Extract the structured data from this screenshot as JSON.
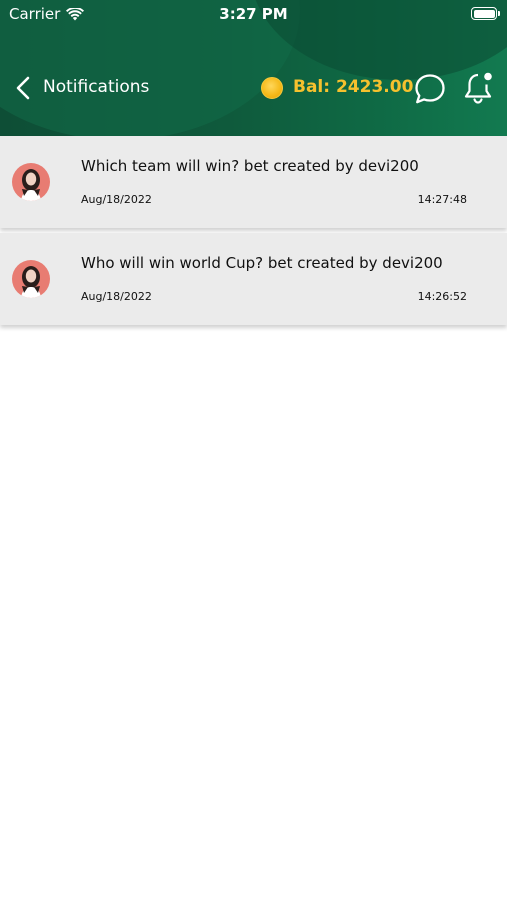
{
  "status_bar": {
    "carrier": "Carrier",
    "time": "3:27 PM"
  },
  "header": {
    "title": "Notifications",
    "balance": "Bal: 2423.00",
    "colors": {
      "background": "#0f5a3c",
      "balance": "#f6c12e"
    }
  },
  "notifications": [
    {
      "message": "Which team will win? bet created by devi200",
      "date": "Aug/18/2022",
      "time": "14:27:48"
    },
    {
      "message": "Who will win world Cup? bet created by devi200",
      "date": "Aug/18/2022",
      "time": "14:26:52"
    }
  ],
  "icons": [
    "back-chevron-icon",
    "coin-icon",
    "chat-bubble-icon",
    "bell-icon",
    "wifi-icon",
    "battery-icon",
    "avatar"
  ]
}
